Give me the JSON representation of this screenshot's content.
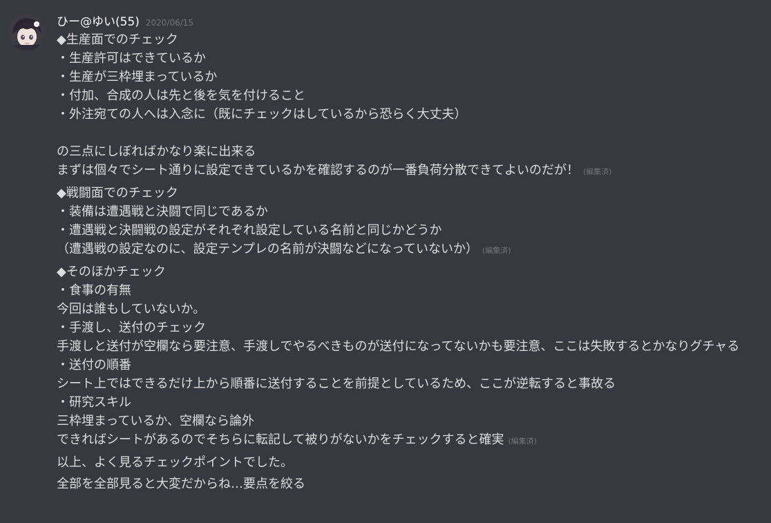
{
  "author": {
    "name": "ひー@ゆい(55)",
    "timestamp": "2020/06/15",
    "avatar_icon": "avatar-icon"
  },
  "colors": {
    "background": "#36393f",
    "text": "#dcddde",
    "username": "#ffffff",
    "muted": "#72767d"
  },
  "messages": [
    {
      "text": "◆生産面でのチェック\n・生産許可はできているか\n・生産が三枠埋まっているか\n・付加、合成の人は先と後を気を付けること\n・外注宛ての人へは入念に（既にチェックはしているから恐らく大丈夫）\n\nの三点にしぼればかなり楽に出来る\nまずは個々でシート通りに設定できているかを確認するのが一番負荷分散できてよいのだが！",
      "edited": "(編集済)"
    },
    {
      "text": "◆戦闘面でのチェック\n・装備は遭遇戦と決闘で同じであるか\n・遭遇戦と決闘戦の設定がそれぞれ設定している名前と同じかどうか\n（遭遇戦の設定なのに、設定テンプレの名前が決闘などになっていないか）",
      "edited": "(編集済)"
    },
    {
      "text": "◆そのほかチェック\n・食事の有無\n今回は誰もしていないか。\n・手渡し、送付のチェック\n手渡しと送付が空欄なら要注意、手渡しでやるべきものが送付になってないかも要注意、ここは失敗するとかなりグチャる\n・送付の順番\nシート上ではできるだけ上から順番に送付することを前提としているため、ここが逆転すると事故る\n・研究スキル\n三枠埋まっているか、空欄なら論外\nできればシートがあるのでそちらに転記して被りがないかをチェックすると確実",
      "edited": "(編集済)"
    },
    {
      "text": "以上、よく見るチェックポイントでした。",
      "edited": ""
    },
    {
      "text": "全部を全部見ると大変だからね…要点を絞る",
      "edited": ""
    }
  ]
}
